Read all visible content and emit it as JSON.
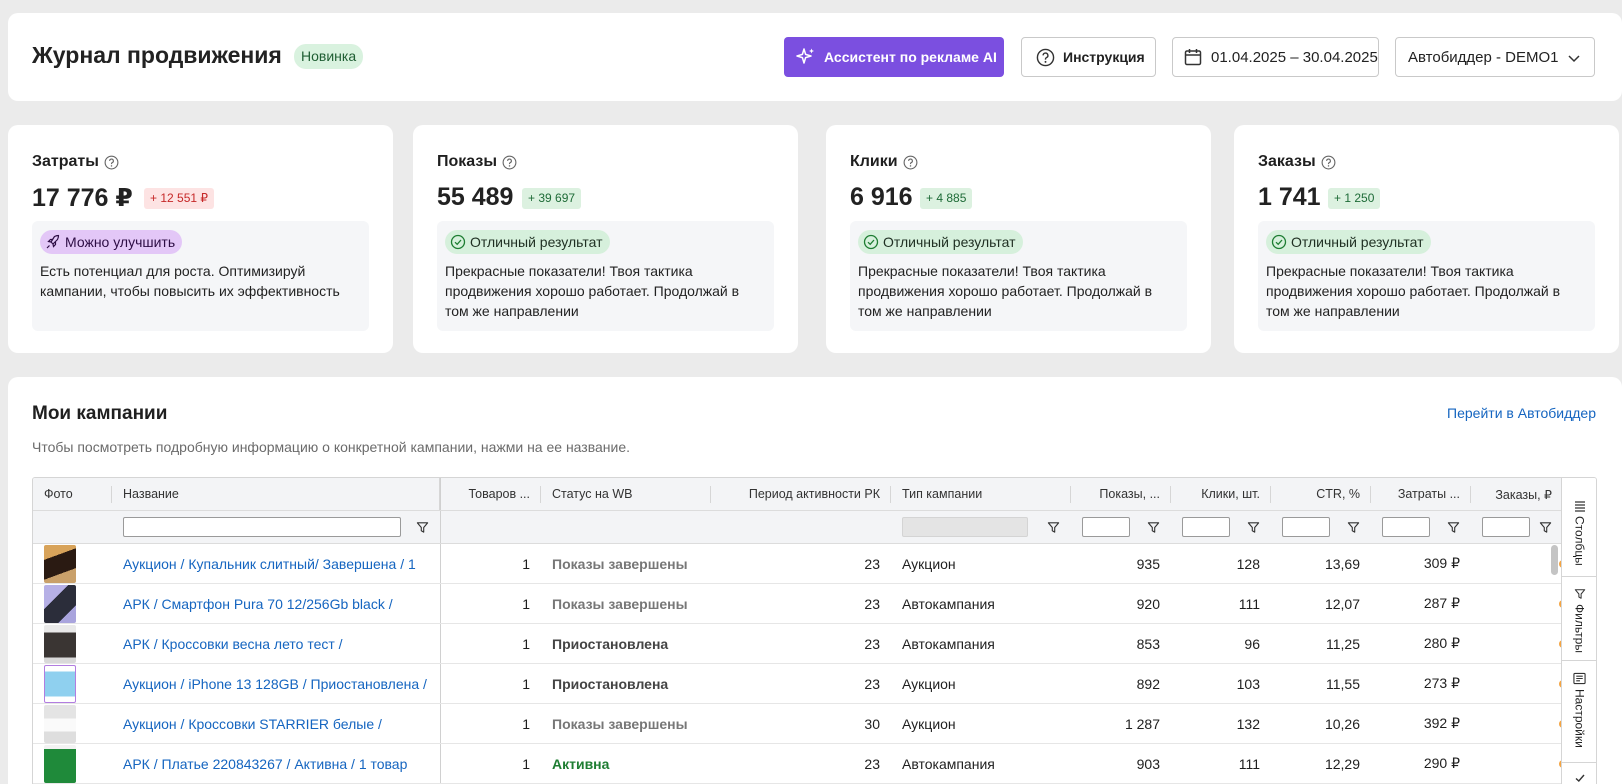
{
  "header": {
    "title": "Журнал продвижения",
    "badge": "Новинка",
    "ai_button": "Ассистент по рекламе AI",
    "help_button": "Инструкция",
    "date_range": "01.04.2025 – 30.04.2025",
    "bidder_select": "Автобиддер - DEMO1"
  },
  "metrics": [
    {
      "label": "Затраты",
      "value": "17 776 ₽",
      "delta": "+ 12 551 ₽",
      "tag": "Можно улучшить",
      "text": "Есть потенциал для роста. Оптимизируй кампании, чтобы повысить их эффективность"
    },
    {
      "label": "Показы",
      "value": "55 489",
      "delta": "+ 39 697",
      "tag": "Отличный результат",
      "text": "Прекрасные показатели! Твоя тактика продвижения хорошо работает. Продолжай в том же направлении"
    },
    {
      "label": "Клики",
      "value": "6 916",
      "delta": "+ 4 885",
      "tag": "Отличный результат",
      "text": "Прекрасные показатели! Твоя тактика продвижения хорошо работает. Продолжай в том же направлении"
    },
    {
      "label": "Заказы",
      "value": "1 741",
      "delta": "+ 1 250",
      "tag": "Отличный результат",
      "text": "Прекрасные показатели! Твоя тактика продвижения хорошо работает. Продолжай в том же направлении"
    }
  ],
  "campaigns": {
    "title": "Мои кампании",
    "subtitle": "Чтобы посмотреть подробную информацию о конкретной кампании, нажми на ее название.",
    "link": "Перейти в Автобиддер",
    "columns": [
      "Фото",
      "Название",
      "Товаров ...",
      "Статус на WB",
      "Период активности РК",
      "Тип кампании",
      "Показы, ...",
      "Клики, шт.",
      "CTR, %",
      "Затраты ...",
      "Заказы, ₽"
    ],
    "rows": [
      {
        "name": "Аукцион / Купальник слитный/ Завершена / 1",
        "items": "1",
        "status": "Показы завершены",
        "period": "23",
        "type": "Аукцион",
        "views": "935",
        "clicks": "128",
        "ctr": "13,69",
        "cost": "309 ₽"
      },
      {
        "name": "АРК / Смартфон Pura 70 12/256Gb black /",
        "items": "1",
        "status": "Показы завершены",
        "period": "23",
        "type": "Автокампания",
        "views": "920",
        "clicks": "111",
        "ctr": "12,07",
        "cost": "287 ₽"
      },
      {
        "name": "АРК / Кроссовки весна лето тест /",
        "items": "1",
        "status": "Приостановлена",
        "period": "23",
        "type": "Автокампания",
        "views": "853",
        "clicks": "96",
        "ctr": "11,25",
        "cost": "280 ₽"
      },
      {
        "name": "Аукцион / iPhone 13 128GB / Приостановлена /",
        "items": "1",
        "status": "Приостановлена",
        "period": "23",
        "type": "Аукцион",
        "views": "892",
        "clicks": "103",
        "ctr": "11,55",
        "cost": "273 ₽"
      },
      {
        "name": "Аукцион / Кроссовки STARRIER белые /",
        "items": "1",
        "status": "Показы завершены",
        "period": "30",
        "type": "Аукцион",
        "views": "1 287",
        "clicks": "132",
        "ctr": "10,26",
        "cost": "392 ₽"
      },
      {
        "name": "АРК / Платье 220843267 / Активна / 1 товар",
        "items": "1",
        "status": "Активна",
        "period": "23",
        "type": "Автокампания",
        "views": "903",
        "clicks": "111",
        "ctr": "12,29",
        "cost": "290 ₽"
      }
    ]
  },
  "side_panel": {
    "columns": "Столбцы",
    "filters": "Фильтры",
    "settings": "Настройки"
  },
  "colors": {
    "accent": "#7b4fe0",
    "link": "#1565c0",
    "active": "#1e7d32"
  }
}
